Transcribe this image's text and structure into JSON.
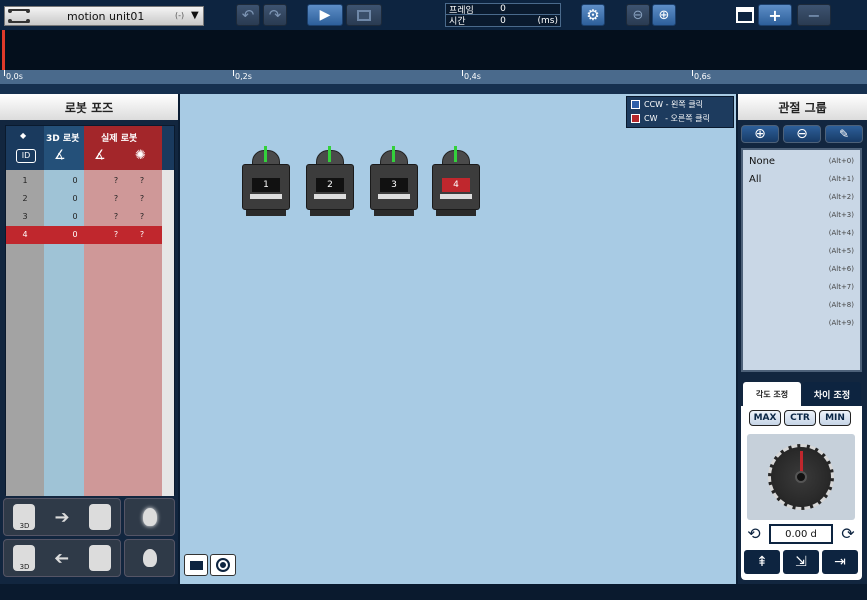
{
  "toolbar": {
    "motion_unit": "motion unit01",
    "motion_suffix": "(-)",
    "frame_label": "프레임",
    "frame_value": "0",
    "time_label": "시간",
    "time_value": "0",
    "time_unit": "(ms)"
  },
  "timeline": {
    "ticks": [
      "0,0s",
      "0,2s",
      "0,4s",
      "0,6s"
    ]
  },
  "left_panel": {
    "title": "로봇 포즈",
    "col_3d": "3D 로봇",
    "col_real": "실제 로봇",
    "id_label": "ID",
    "rows": [
      {
        "id": "1",
        "angle": "0",
        "real_angle": "?",
        "real_light": "?"
      },
      {
        "id": "2",
        "angle": "0",
        "real_angle": "?",
        "real_light": "?"
      },
      {
        "id": "3",
        "angle": "0",
        "real_angle": "?",
        "real_light": "?"
      },
      {
        "id": "4",
        "angle": "0",
        "real_angle": "?",
        "real_light": "?"
      }
    ],
    "selected_row": 4
  },
  "canvas": {
    "legend_ccw": "CCW - 왼쪽 클릭",
    "legend_cw": "CW   - 오른쪽 클릭",
    "servos": [
      "1",
      "2",
      "3",
      "4"
    ],
    "selected_servo": "4"
  },
  "right_panel": {
    "title": "관절 그룹",
    "groups": [
      {
        "name": "None",
        "shortcut": "(Alt+0)"
      },
      {
        "name": "All",
        "shortcut": "(Alt+1)"
      },
      {
        "name": "",
        "shortcut": "(Alt+2)"
      },
      {
        "name": "",
        "shortcut": "(Alt+3)"
      },
      {
        "name": "",
        "shortcut": "(Alt+4)"
      },
      {
        "name": "",
        "shortcut": "(Alt+5)"
      },
      {
        "name": "",
        "shortcut": "(Alt+6)"
      },
      {
        "name": "",
        "shortcut": "(Alt+7)"
      },
      {
        "name": "",
        "shortcut": "(Alt+8)"
      },
      {
        "name": "",
        "shortcut": "(Alt+9)"
      }
    ],
    "tab_angle": "각도 조정",
    "tab_diff": "차이 조정",
    "btn_max": "MAX",
    "btn_ctr": "CTR",
    "btn_min": "MIN",
    "angle_value": "0.00 d"
  },
  "colors": {
    "ccw": "#2e5fa8",
    "cw": "#b5282c",
    "selected": "#c0272d"
  }
}
